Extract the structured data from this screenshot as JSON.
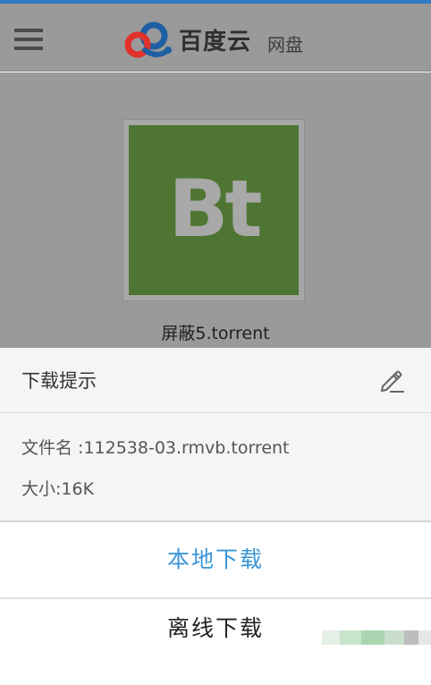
{
  "app": {
    "brand_name": "百度云",
    "brand_sub": "网盘"
  },
  "header": {
    "menu_icon": "hamburger-menu-icon",
    "logo_icon": "baidu-cloud-logo-icon"
  },
  "file": {
    "thumbnail_label": "Bt",
    "thumbnail_icon": "bt-torrent-icon",
    "display_name": "屏蔽5.torrent"
  },
  "dialog": {
    "title": "下载提示",
    "edit_icon": "pencil-edit-icon",
    "file_name_line": "文件名 :112538-03.rmvb.torrent",
    "size_line": "大小:16K",
    "local_download": "本地下载",
    "offline_download": "离线下载"
  },
  "colors": {
    "accent": "#3a95d6",
    "header_stripe": "#2f7bc5",
    "thumbnail_bg": "#4e7632",
    "overlay": "#9a9a9a"
  }
}
